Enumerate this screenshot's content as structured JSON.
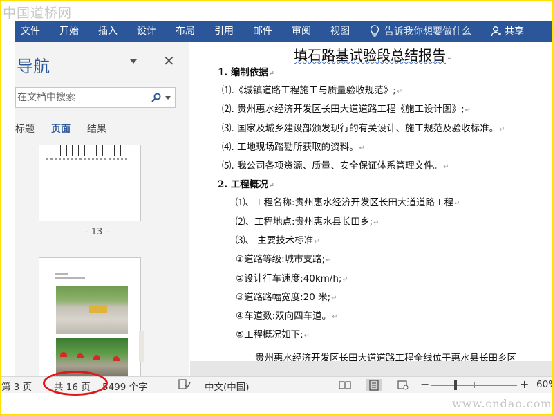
{
  "watermark": {
    "site_name": "中国道桥网",
    "url": "www.cndao.com"
  },
  "ribbon": {
    "tabs": [
      "文件",
      "开始",
      "插入",
      "设计",
      "布局",
      "引用",
      "邮件",
      "审阅",
      "视图"
    ],
    "tell_me": "告诉我你想要做什么",
    "share": "共享",
    "color": "#2b579a"
  },
  "nav": {
    "title": "导航",
    "search_placeholder": "在文档中搜索",
    "tabs": [
      "标题",
      "页面",
      "结果"
    ],
    "active_tab": "页面",
    "page_label": "- 13 -"
  },
  "doc": {
    "title": "填石路基试验段总结报告",
    "section1": "1. 编制依据",
    "items1": [
      "⑴.《城镇道路工程施工与质量验收规范》;",
      "⑵. 贵州惠水经济开发区长田大道道路工程《施工设计图》;",
      "⑶. 国家及城乡建设部颁发现行的有关设计、施工规范及验收标准。",
      "⑷. 工地现场踏勘所获取的资料。",
      "⑸. 我公司各项资源、质量、安全保证体系管理文件。"
    ],
    "section2": "2. 工程概况",
    "items2": [
      "⑴、工程名称:贵州惠水经济开发区长田大道道路工程",
      "⑵、工程地点:贵州惠水县长田乡;",
      "⑶、 主要技术标准",
      "①道路等级:城市支路;",
      "②设计行车速度:40km/h;",
      "③道路路幅宽度:20 米;",
      "④车道数:双向四车道。",
      "⑤工程概况如下:"
    ],
    "partial_line": "贵州惠水经济开发区长田大道道路工程全线位于惠水县长田乡区"
  },
  "status": {
    "page": "第 3 页",
    "total": "共 16 页",
    "words": "5499 个字",
    "language": "中文(中国)",
    "zoom": "60%"
  }
}
